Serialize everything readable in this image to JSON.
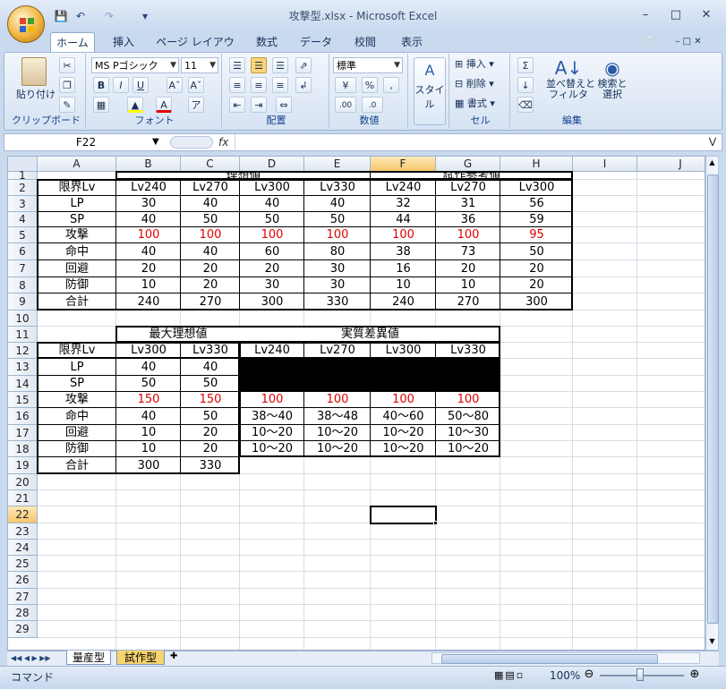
{
  "window": {
    "title": "攻撃型.xlsx - Microsoft Excel"
  },
  "tabs": [
    "ホーム",
    "挿入",
    "ページ レイアウト",
    "数式",
    "データ",
    "校閲",
    "表示"
  ],
  "ribbon": {
    "font_name": "MS Pゴシック",
    "font_size": "11",
    "number_format": "標準",
    "paste_label": "貼り付け",
    "style_label": "スタイル",
    "insert_label": "挿入",
    "delete_label": "削除",
    "format_label": "書式",
    "sort_label": "並べ替えと\nフィルタ",
    "find_label": "検索と\n選択",
    "groups": [
      "クリップボード",
      "フォント",
      "配置",
      "数値",
      "セル",
      "編集"
    ]
  },
  "formula_bar": {
    "name_box": "F22",
    "fx": "fx",
    "value": ""
  },
  "columns": [
    "A",
    "B",
    "C",
    "D",
    "E",
    "F",
    "G",
    "H",
    "I",
    "J"
  ],
  "rows": [
    "1",
    "2",
    "3",
    "4",
    "5",
    "6",
    "7",
    "8",
    "9",
    "10",
    "11",
    "12",
    "13",
    "14",
    "15",
    "16",
    "17",
    "18",
    "19",
    "20",
    "21",
    "22",
    "23",
    "24",
    "25",
    "26",
    "27",
    "28",
    "29"
  ],
  "selected_cell": "F22",
  "table1": {
    "header_ideal": "理想値",
    "header_proto": "試作参考値",
    "row2": [
      "限界Lv",
      "Lv240",
      "Lv270",
      "Lv300",
      "Lv330",
      "Lv240",
      "Lv270",
      "Lv300"
    ],
    "rows": [
      [
        "LP",
        "30",
        "40",
        "40",
        "40",
        "32",
        "31",
        "56"
      ],
      [
        "SP",
        "40",
        "50",
        "50",
        "50",
        "44",
        "36",
        "59"
      ],
      [
        "攻撃",
        "100",
        "100",
        "100",
        "100",
        "100",
        "100",
        "95"
      ],
      [
        "命中",
        "40",
        "40",
        "60",
        "80",
        "38",
        "73",
        "50"
      ],
      [
        "回避",
        "20",
        "20",
        "20",
        "30",
        "16",
        "20",
        "20"
      ],
      [
        "防御",
        "10",
        "20",
        "30",
        "30",
        "10",
        "10",
        "20"
      ],
      [
        "合計",
        "240",
        "270",
        "300",
        "330",
        "240",
        "270",
        "300"
      ]
    ]
  },
  "table2": {
    "header_max": "最大理想値",
    "header_diff": "実質差異値",
    "row12": [
      "限界Lv",
      "Lv300",
      "Lv330",
      "Lv240",
      "Lv270",
      "Lv300",
      "Lv330"
    ],
    "rows": [
      [
        "LP",
        "40",
        "40",
        "",
        "",
        "",
        ""
      ],
      [
        "SP",
        "50",
        "50",
        "",
        "",
        "",
        ""
      ],
      [
        "攻撃",
        "150",
        "150",
        "100",
        "100",
        "100",
        "100"
      ],
      [
        "命中",
        "40",
        "50",
        "38〜40",
        "38〜48",
        "40〜60",
        "50〜80"
      ],
      [
        "回避",
        "10",
        "20",
        "10〜20",
        "10〜20",
        "10〜20",
        "10〜30"
      ],
      [
        "防御",
        "10",
        "20",
        "10〜20",
        "10〜20",
        "10〜20",
        "10〜20"
      ],
      [
        "合計",
        "300",
        "330",
        "",
        "",
        "",
        ""
      ]
    ]
  },
  "sheets": [
    "量産型",
    "試作型"
  ],
  "status": {
    "mode": "コマンド",
    "zoom": "100%"
  }
}
